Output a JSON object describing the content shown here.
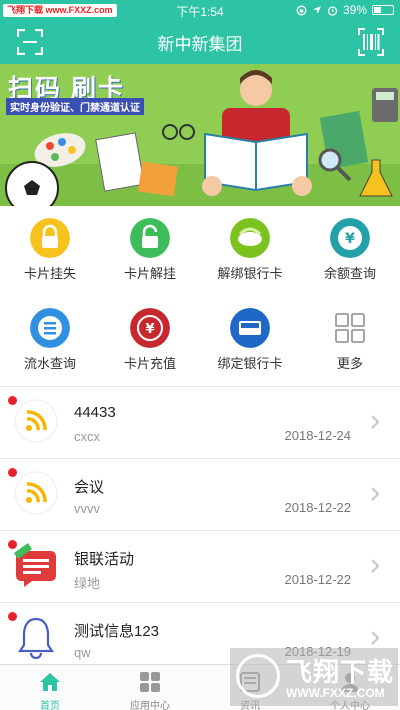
{
  "status_bar": {
    "watermark_badge": "飞翔下载 www.FXXZ.com",
    "time": "下午1:54",
    "battery": "39%"
  },
  "nav": {
    "title": "新中新集团",
    "left_icon": "scan-icon",
    "right_icon": "barcode-icon"
  },
  "banner": {
    "title": "扫码 刷卡",
    "subtitle": "实时身份验证、门禁通道认证"
  },
  "quick_actions": [
    {
      "label": "卡片挂失",
      "icon": "lock-icon",
      "color": "#f6c21e"
    },
    {
      "label": "卡片解挂",
      "icon": "unlock-icon",
      "color": "#3dbd5a"
    },
    {
      "label": "解绑银行卡",
      "icon": "card-unbind-icon",
      "color": "#7cc21e"
    },
    {
      "label": "余额查询",
      "icon": "yen-icon",
      "color": "#24a0a9"
    },
    {
      "label": "流水查询",
      "icon": "list-icon",
      "color": "#2f8fe0"
    },
    {
      "label": "卡片充值",
      "icon": "recharge-icon",
      "color": "#c6282e"
    },
    {
      "label": "绑定银行卡",
      "icon": "unionpay-icon",
      "color": "#1f68c8"
    },
    {
      "label": "更多",
      "icon": "grid-icon",
      "color": "#9a9a9a"
    }
  ],
  "messages": [
    {
      "title": "44433",
      "subtitle": "cxcx",
      "date": "2018-12-24",
      "icon": "rss-icon"
    },
    {
      "title": "会议",
      "subtitle": "vvvv",
      "date": "2018-12-22",
      "icon": "rss-icon"
    },
    {
      "title": "银联活动",
      "subtitle": "绿地",
      "date": "2018-12-22",
      "icon": "message-new-icon"
    },
    {
      "title": "测试信息123",
      "subtitle": "qw",
      "date": "2018-12-19",
      "icon": "bell-icon"
    }
  ],
  "tabbar": [
    {
      "label": "首页",
      "icon": "home-icon",
      "active": true
    },
    {
      "label": "应用中心",
      "icon": "apps-icon",
      "active": false
    },
    {
      "label": "资讯",
      "icon": "news-icon",
      "active": false
    },
    {
      "label": "个人中心",
      "icon": "user-icon",
      "active": false
    }
  ],
  "watermark": {
    "text": "飞翔下载",
    "url": "WWW.FXXZ.COM"
  },
  "colors": {
    "primary": "#2cc4a4",
    "unread_dot": "#e3232c"
  }
}
